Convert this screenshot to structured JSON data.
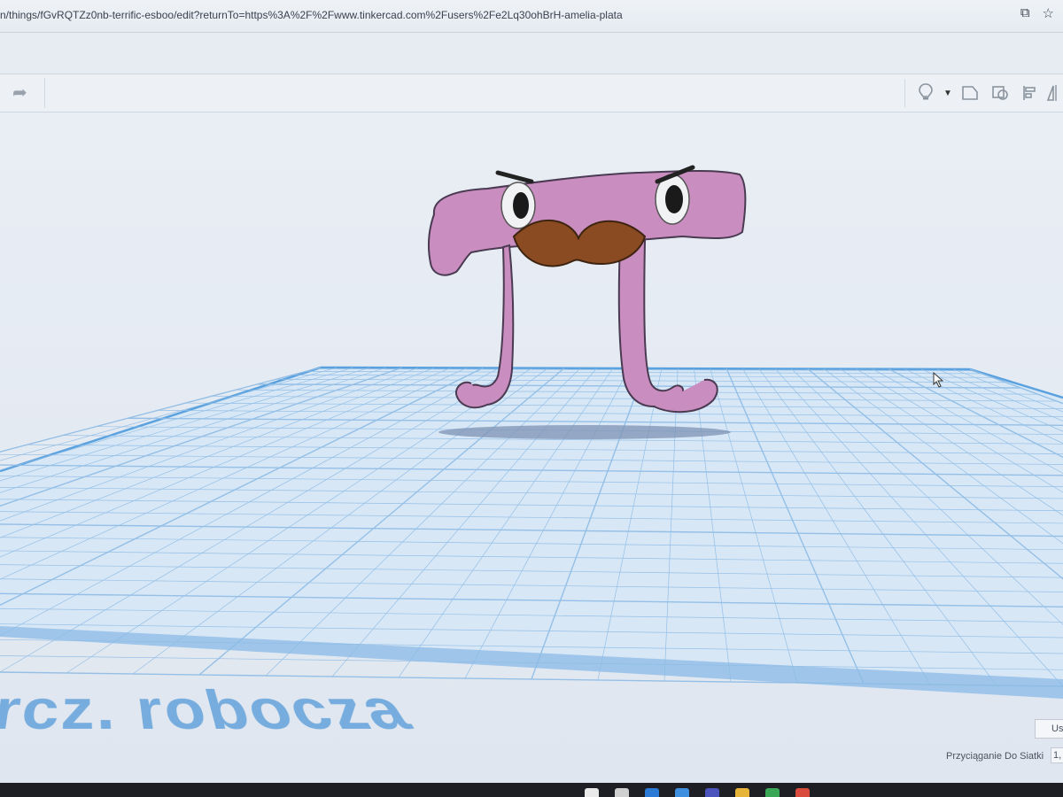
{
  "browser": {
    "url": "n/things/fGvRQTZz0nb-terrific-esboo/edit?returnTo=https%3A%2F%2Fwww.tinkercad.com%2Fusers%2Fe2Lq30ohBrH-amelia-plata",
    "icons": [
      "bookmark-add-icon",
      "star-icon"
    ]
  },
  "toolbar": {
    "left_icons": [
      "redo-icon"
    ],
    "right_icons": [
      "lightbulb-icon",
      "dropdown-arrow-icon",
      "shape-outline-icon",
      "group-icon",
      "align-icon",
      "mirror-icon"
    ]
  },
  "workplane": {
    "label": "rcz. robocza",
    "grid_color": "#7fb3e0",
    "plane_color": "#d7e7f6"
  },
  "model": {
    "body_color": "#c98dbf",
    "mustache_color": "#8a4a22"
  },
  "footer": {
    "snap_label": "Przyciąganie Do Siatki",
    "snap_value": "1,",
    "us_label": "Us"
  },
  "colors": {
    "accent": "#6aa6dc"
  }
}
